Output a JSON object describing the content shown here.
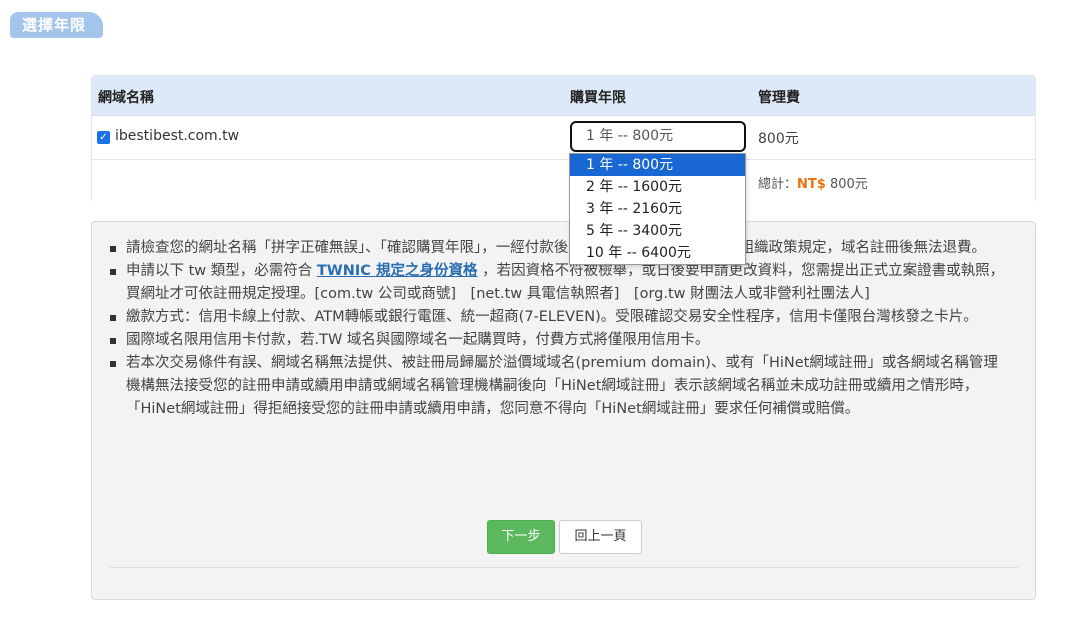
{
  "section_tab": "選擇年限",
  "table": {
    "headers": {
      "domain": "網域名稱",
      "years": "購買年限",
      "fee": "管理費"
    },
    "row": {
      "checked": true,
      "check_glyph": "✓",
      "domain": "ibestibest.com.tw",
      "selected_period": "1 年 -- 800元",
      "fee": "800元"
    },
    "total": {
      "label": "總計：",
      "currency": "NT$",
      "amount": " 800元"
    }
  },
  "period_options": [
    "1 年 -- 800元",
    "2 年 -- 1600元",
    "3 年 -- 2160元",
    "5 年 -- 3400元",
    "10 年 -- 6400元"
  ],
  "notice": {
    "item1": "請檢查您的網址名稱「拼字正確無誤」、「確認購買年限」，一經付款後，依據國際域名之 ICANN 組織政策規定，域名註冊後無法退費。",
    "item2_prefix": "申請以下 tw 類型，必需符合 ",
    "item2_link": "TWNIC 規定之身份資格",
    "item2_suffix": " ，若因資格不符被檢舉，或日後要申請更改資料，您需提出正式立案證書或執照，買網址才可依註冊規定授理。[com.tw 公司或商號]　[net.tw 具電信執照者]　[org.tw 財團法人或非營利社團法人]",
    "item3": "繳款方式：信用卡線上付款、ATM轉帳或銀行電匯、統一超商(7-ELEVEN)。受限確認交易安全性程序，信用卡僅限台灣核發之卡片。",
    "item4": "國際域名限用信用卡付款，若.TW 域名與國際域名一起購買時，付費方式將僅限用信用卡。",
    "item5": "若本次交易條件有誤、網域名稱無法提供、被註冊局歸屬於溢價域域名(premium domain)、或有「HiNet網域註冊」或各網域名稱管理機構無法接受您的註冊申請或續用申請或網域名稱管理機構嗣後向「HiNet網域註冊」表示該網域名稱並未成功註冊或續用之情形時，「HiNet網域註冊」得拒絕接受您的註冊申請或續用申請，您同意不得向「HiNet網域註冊」要求任何補償或賠償。"
  },
  "buttons": {
    "next": "下一步",
    "back": "回上一頁"
  }
}
